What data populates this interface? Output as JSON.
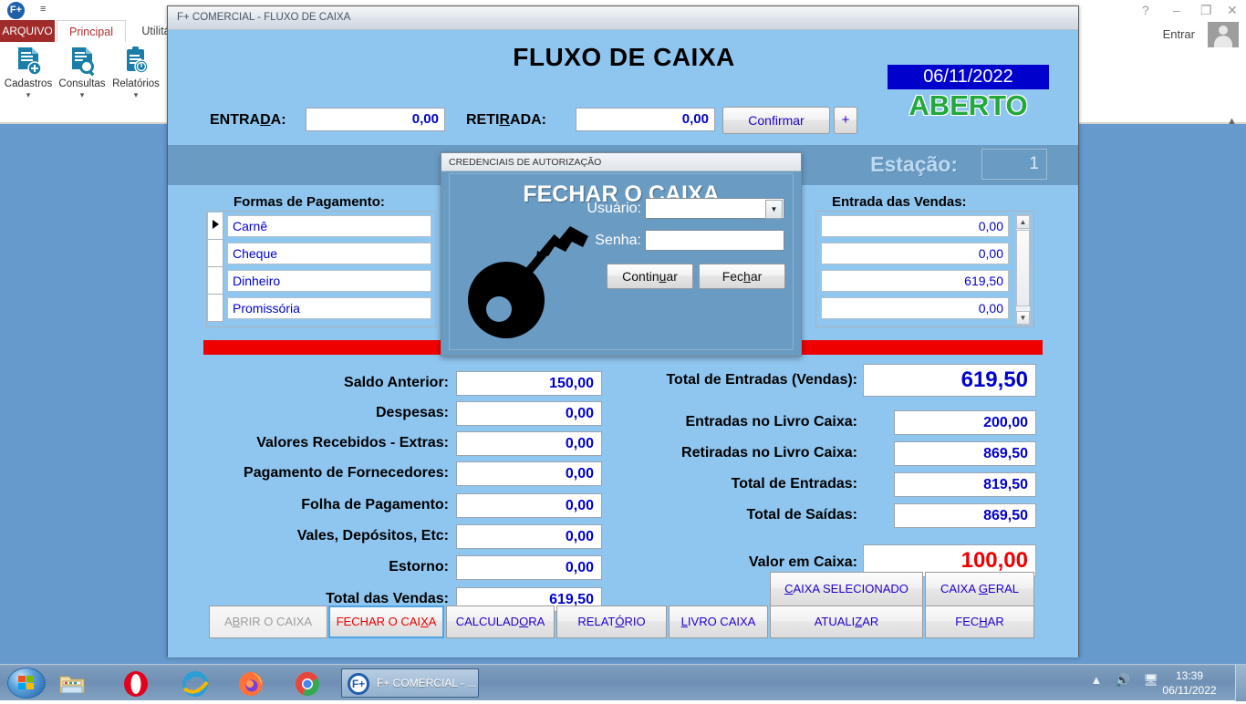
{
  "background_app": {
    "quick_access": {
      "orb": "F+",
      "caret_icon": "chevron-down-icon"
    },
    "window_controls": {
      "help": "?",
      "minimize": "–",
      "restore": "❐",
      "close": "✕"
    },
    "signin_label": "Entrar",
    "tabs": [
      {
        "label": "ARQUIVO",
        "active": false
      },
      {
        "label": "Principal",
        "active": true
      },
      {
        "label": "Utilitá",
        "active": false
      }
    ],
    "ribbon_buttons": [
      {
        "label": "Cadastros",
        "icon": "document-add-icon",
        "dropdown": "▾"
      },
      {
        "label": "Consultas",
        "icon": "document-search-icon",
        "dropdown": "▾"
      },
      {
        "label": "Relatórios",
        "icon": "clipboard-clock-icon",
        "dropdown": "▾"
      }
    ],
    "collapse_ribbon_icon": "chevron-up-icon"
  },
  "app_window": {
    "title": "F+ COMERCIAL - FLUXO DE CAIXA",
    "form_title": "FLUXO DE CAIXA",
    "date": "06/11/2022",
    "status": "ABERTO",
    "status_color": "#23a83c",
    "date_bg": "#0000cc",
    "entrada_label": "ENTRADA:",
    "entrada_value": "0,00",
    "retirada_label": "RETIRADA:",
    "retirada_value": "0,00",
    "confirmar_label": "Confirmar",
    "plus_label": "+",
    "station_label": "Estação:",
    "station_value": "1",
    "payments": {
      "heading": "Formas de Pagamento:",
      "items": [
        "Carnê",
        "Cheque",
        "Dinheiro",
        "Promissória"
      ],
      "selected_index": 0
    },
    "sales_entries": {
      "heading": "Entrada das Vendas:",
      "values": [
        "0,00",
        "0,00",
        "619,50",
        "0,00"
      ],
      "scroll_up_icon": "triangle-up-icon",
      "scroll_down_icon": "triangle-down-icon"
    },
    "left_fields": [
      {
        "label": "Saldo Anterior:",
        "value": "150,00"
      },
      {
        "label": "Despesas:",
        "value": "0,00"
      },
      {
        "label": "Valores Recebidos - Extras:",
        "value": "0,00"
      },
      {
        "label": "Pagamento de Fornecedores:",
        "value": "0,00"
      },
      {
        "label": "Folha de Pagamento:",
        "value": "0,00"
      },
      {
        "label": "Vales, Depósitos, Etc:",
        "value": "0,00"
      },
      {
        "label": "Estorno:",
        "value": "0,00"
      },
      {
        "label": "Total das Vendas:",
        "value": "619,50"
      }
    ],
    "right_fields": [
      {
        "label": "Total de Entradas (Vendas):",
        "value": "619,50"
      },
      {
        "label": "Entradas no Livro Caixa:",
        "value": "200,00"
      },
      {
        "label": "Retiradas no Livro Caixa:",
        "value": "869,50"
      },
      {
        "label": "Total de Entradas:",
        "value": "819,50"
      },
      {
        "label": "Total de Saídas:",
        "value": "869,50"
      }
    ],
    "cash_total": {
      "label": "Valor em Caixa:",
      "value": "100,00",
      "color": "#ee0000"
    },
    "top_buttons": [
      {
        "label": "CAIXA SELECIONADO"
      },
      {
        "label": "CAIXA GERAL"
      }
    ],
    "bottom_buttons": [
      {
        "label": "ABRIR O CAIXA",
        "state": "disabled"
      },
      {
        "label": "FECHAR O CAIXA",
        "state": "focused"
      },
      {
        "label": "CALCULADORA",
        "state": "normal"
      },
      {
        "label": "RELATÓRIO",
        "state": "normal"
      },
      {
        "label": "LIVRO CAIXA",
        "state": "normal"
      },
      {
        "label": "ATUALIZAR",
        "state": "normal"
      },
      {
        "label": "FECHAR",
        "state": "normal"
      }
    ]
  },
  "modal": {
    "titlebar": "CREDENCIAIS DE AUTORIZAÇÃO",
    "heading": "FECHAR O CAIXA",
    "icon": "key-icon",
    "user_label": "Usuário:",
    "user_value": "",
    "password_label": "Senha:",
    "password_value": "",
    "continue_label": "Continuar",
    "close_label": "Fechar"
  },
  "taskbar": {
    "start_icon": "windows-start-icon",
    "pinned": [
      {
        "name": "file-explorer-icon"
      },
      {
        "name": "opera-icon"
      },
      {
        "name": "internet-explorer-icon"
      },
      {
        "name": "firefox-icon"
      },
      {
        "name": "chrome-icon"
      }
    ],
    "task": {
      "orb": "F+",
      "label": "F+ COMERCIAL - ..."
    },
    "tray": {
      "overflow_icon": "chevron-up-icon",
      "volume_icon": "speaker-icon",
      "network_icon": "network-icon"
    },
    "time": "13:39",
    "date": "06/11/2022"
  }
}
